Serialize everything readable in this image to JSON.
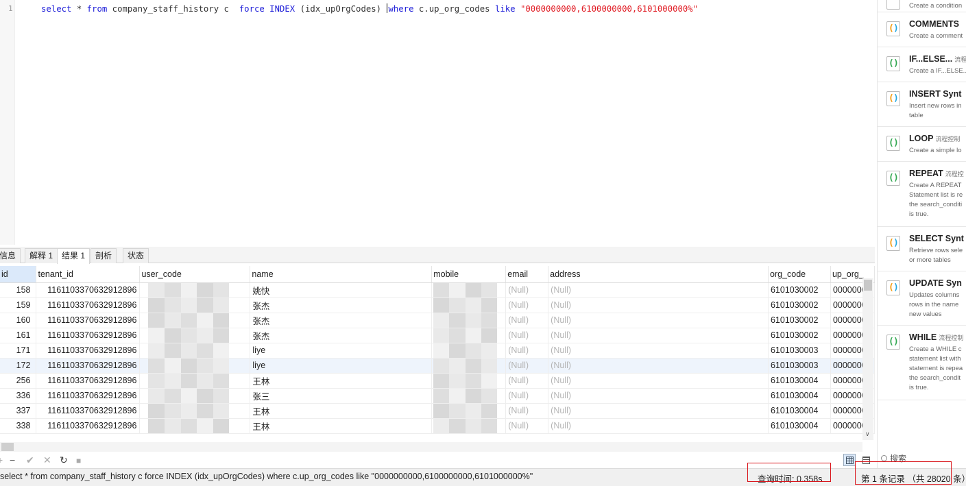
{
  "editor": {
    "line_number": "1",
    "sql": {
      "t1": "select",
      "t2": " * ",
      "t3": "from",
      "t4": " company_staff_history c  ",
      "t5": "force INDEX",
      "t6": " (idx_upOrgCodes) ",
      "t7": "where",
      "t8": " c.up_org_codes ",
      "t9": "like",
      "t10": " ",
      "t11": "\"0000000000,6100000000,6101000000%\""
    }
  },
  "snippets": {
    "items": [
      {
        "title": "",
        "tag": "",
        "desc": [
          "Create a condition"
        ],
        "icon": "green"
      },
      {
        "title": "COMMENTS",
        "tag": "",
        "desc": [
          "Create a comment"
        ],
        "icon": "orange"
      },
      {
        "title": "IF...ELSE...",
        "tag": "流程",
        "desc": [
          "Create a IF...ELSE..."
        ],
        "icon": "green"
      },
      {
        "title": "INSERT Synt",
        "tag": "",
        "desc": [
          "Insert new rows in",
          "table"
        ],
        "icon": "orange"
      },
      {
        "title": "LOOP",
        "tag": "流程控制",
        "desc": [
          "Create a simple lo"
        ],
        "icon": "green"
      },
      {
        "title": "REPEAT",
        "tag": "流程控",
        "desc": [
          "Create A REPEAT",
          "Statement list is re",
          "the search_conditi",
          "is true."
        ],
        "icon": "green"
      },
      {
        "title": "SELECT Synt",
        "tag": "",
        "desc": [
          "Retrieve rows sele",
          "or more tables"
        ],
        "icon": "orange"
      },
      {
        "title": "UPDATE Syn",
        "tag": "",
        "desc": [
          "Updates columns",
          "rows in the name",
          "new values"
        ],
        "icon": "orange"
      },
      {
        "title": "WHILE",
        "tag": "流程控制",
        "desc": [
          "Create a WHILE c",
          "statement list with",
          "statement is repea",
          "the search_condit",
          "is true."
        ],
        "icon": "green"
      }
    ],
    "search_label": "搜索"
  },
  "tabs": [
    "信息",
    "解释 1",
    "结果 1",
    "剖析",
    "状态"
  ],
  "active_tab": "结果 1",
  "grid": {
    "columns": [
      "id",
      "tenant_id",
      "user_code",
      "name",
      "mobile",
      "email",
      "address",
      "org_code",
      "up_org_"
    ],
    "rows": [
      {
        "id": "158",
        "tenant_id": "1161103370632912896",
        "name": "姚快",
        "mobile": "1995997716",
        "email": "(Null)",
        "address": "(Null)",
        "org_code": "6101030002",
        "up_org": "0000000"
      },
      {
        "id": "159",
        "tenant_id": "1161103370632912896",
        "name": "张杰",
        "mobile": "",
        "email": "(Null)",
        "address": "(Null)",
        "org_code": "6101030002",
        "up_org": "0000000"
      },
      {
        "id": "160",
        "tenant_id": "1161103370632912896",
        "name": "张杰",
        "mobile": "",
        "email": "(Null)",
        "address": "(Null)",
        "org_code": "6101030002",
        "up_org": "0000000"
      },
      {
        "id": "161",
        "tenant_id": "1161103370632912896",
        "name": "张杰",
        "mobile": "",
        "email": "(Null)",
        "address": "(Null)",
        "org_code": "6101030002",
        "up_org": "0000000"
      },
      {
        "id": "171",
        "tenant_id": "1161103370632912896",
        "name": "liye",
        "mobile": "",
        "email": "(Null)",
        "address": "(Null)",
        "org_code": "6101030003",
        "up_org": "0000000"
      },
      {
        "id": "172",
        "tenant_id": "1161103370632912896",
        "name": "liye",
        "mobile": "",
        "email": "(Null)",
        "address": "(Null)",
        "org_code": "6101030003",
        "up_org": "0000000"
      },
      {
        "id": "256",
        "tenant_id": "1161103370632912896",
        "name": "王林",
        "mobile": "",
        "email": "(Null)",
        "address": "(Null)",
        "org_code": "6101030004",
        "up_org": "0000000"
      },
      {
        "id": "336",
        "tenant_id": "1161103370632912896",
        "name": "张三",
        "mobile": "",
        "email": "(Null)",
        "address": "(Null)",
        "org_code": "6101030004",
        "up_org": "0000000"
      },
      {
        "id": "337",
        "tenant_id": "1161103370632912896",
        "name": "王林",
        "mobile": "",
        "email": "(Null)",
        "address": "(Null)",
        "org_code": "6101030004",
        "up_org": "0000000"
      },
      {
        "id": "338",
        "tenant_id": "1161103370632912896",
        "name": "王林",
        "mobile": "",
        "email": "(Null)",
        "address": "(Null)",
        "org_code": "6101030004",
        "up_org": "0000000"
      }
    ],
    "selected_row": "172"
  },
  "toolbar": {
    "add_icon": "+",
    "remove_icon": "−",
    "apply_icon": "✔",
    "discard_icon": "✕",
    "refresh_icon": "↻",
    "stop_icon": "■"
  },
  "status": {
    "sql": "select * from company_staff_history c  force INDEX (idx_upOrgCodes) where c.up_org_codes like \"0000000000,6100000000,6101000000%\"",
    "query_time": "查询时间: 0.358s",
    "records": "第 1 条记录 （共 28020 条）"
  },
  "colors": {
    "keyword": "#1b1bd8",
    "string": "#e01a22",
    "null": "#b5b5b5",
    "highlight_box": "#d9161c",
    "selection": "#dbe9fa"
  }
}
